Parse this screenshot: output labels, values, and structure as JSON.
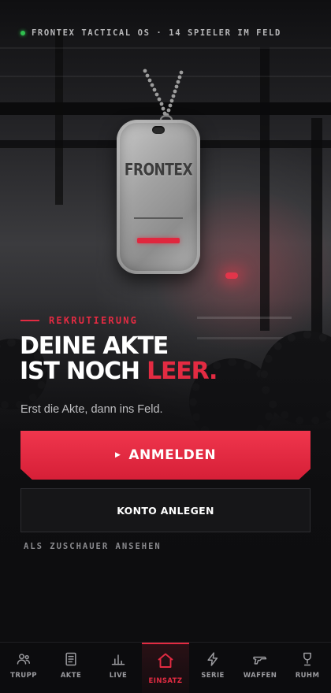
{
  "status": {
    "text": "FRONTEX TACTICAL OS · 14 SPIELER IM FELD",
    "dot_color": "#2fbf4f"
  },
  "dogtag": {
    "engraving": "FRONTEX"
  },
  "hero": {
    "eyebrow": "REKRUTIERUNG",
    "headline_line1": "DEINE AKTE",
    "headline_line2": "IST NOCH",
    "headline_accent": "LEER.",
    "subline": "Erst die Akte, dann ins Feld."
  },
  "actions": {
    "primary_label": "ANMELDEN",
    "primary_icon": "play-icon",
    "secondary_label": "KONTO ANLEGEN",
    "spectate_label": "ALS ZUSCHAUER ANSEHEN"
  },
  "tabs": [
    {
      "label": "TRUPP",
      "icon": "users-icon",
      "active": false
    },
    {
      "label": "AKTE",
      "icon": "document-icon",
      "active": false
    },
    {
      "label": "LIVE",
      "icon": "bar-chart-icon",
      "active": false
    },
    {
      "label": "EINSATZ",
      "icon": "home-icon",
      "active": true
    },
    {
      "label": "SERIE",
      "icon": "lightning-icon",
      "active": false
    },
    {
      "label": "WAFFEN",
      "icon": "gun-icon",
      "active": false
    },
    {
      "label": "RUHM",
      "icon": "trophy-icon",
      "active": false
    }
  ],
  "colors": {
    "accent": "#e32b42",
    "background": "#0d0d0f"
  }
}
